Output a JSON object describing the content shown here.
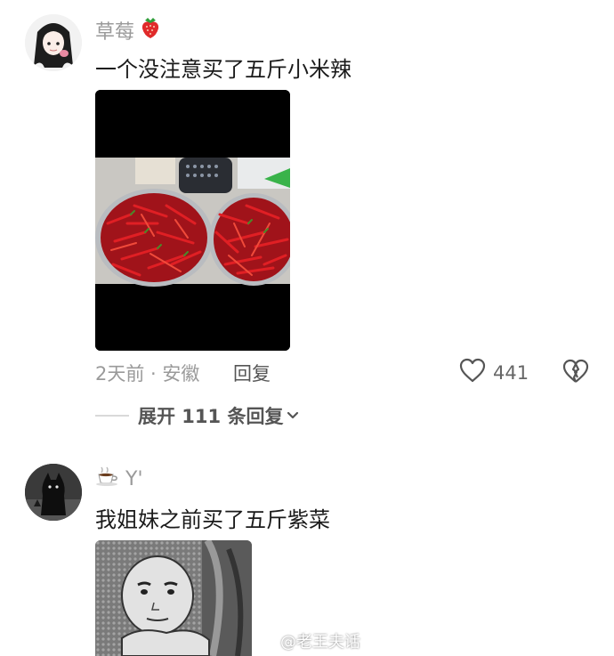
{
  "comments": [
    {
      "username": "草莓",
      "username_emoji": "🍓",
      "text": "一个没注意买了五斤小米辣",
      "time_location": "2天前 · 安徽",
      "reply_label": "回复",
      "like_count": "441",
      "expand_label": "展开 111 条回复"
    },
    {
      "username": "Y'",
      "username_emoji": "☕",
      "text": "我姐妹之前买了五斤紫菜"
    }
  ],
  "watermark": {
    "text": "@老王夫话"
  },
  "icons": {
    "like": "heart-outline-icon",
    "dislike": "broken-heart-icon",
    "expand": "chevron-down-icon"
  },
  "colors": {
    "meta_gray": "#9a9a9a",
    "chili_red": "#c0141c",
    "photo_black": "#000000"
  }
}
